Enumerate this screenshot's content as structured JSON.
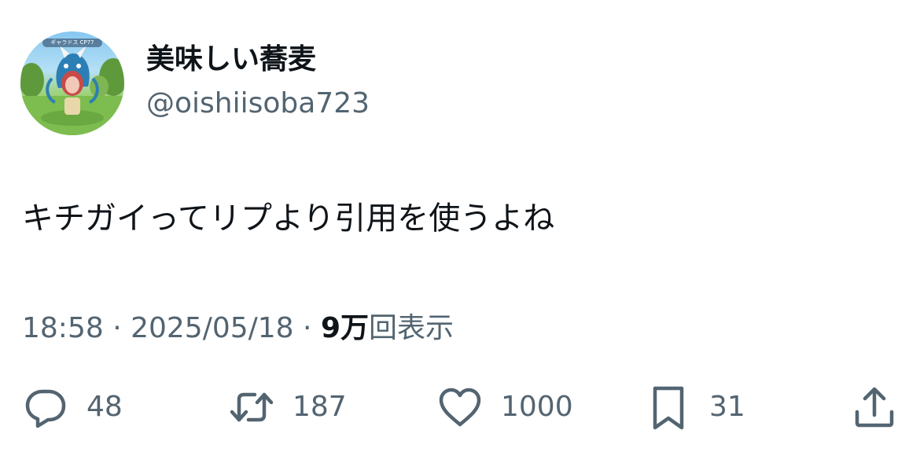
{
  "user": {
    "display_name": "美味しい蕎麦",
    "handle": "@oishiisoba723",
    "avatar_tag": "ギャラドス  CP77"
  },
  "tweet": {
    "text": "キチガイってリプより引用を使うよね",
    "time": "18:58",
    "date": "2025/05/18",
    "views_count": "9万",
    "views_label": "回表示",
    "separator": " · "
  },
  "actions": {
    "reply_count": "48",
    "retweet_count": "187",
    "like_count": "1000",
    "bookmark_count": "31"
  },
  "icons": {
    "reply": "speech-bubble-icon",
    "retweet": "retweet-arrows-icon",
    "like": "heart-icon",
    "bookmark": "bookmark-icon",
    "share": "share-upload-icon"
  },
  "colors": {
    "text_primary": "#0f1419",
    "text_secondary": "#536471",
    "background": "#ffffff"
  }
}
